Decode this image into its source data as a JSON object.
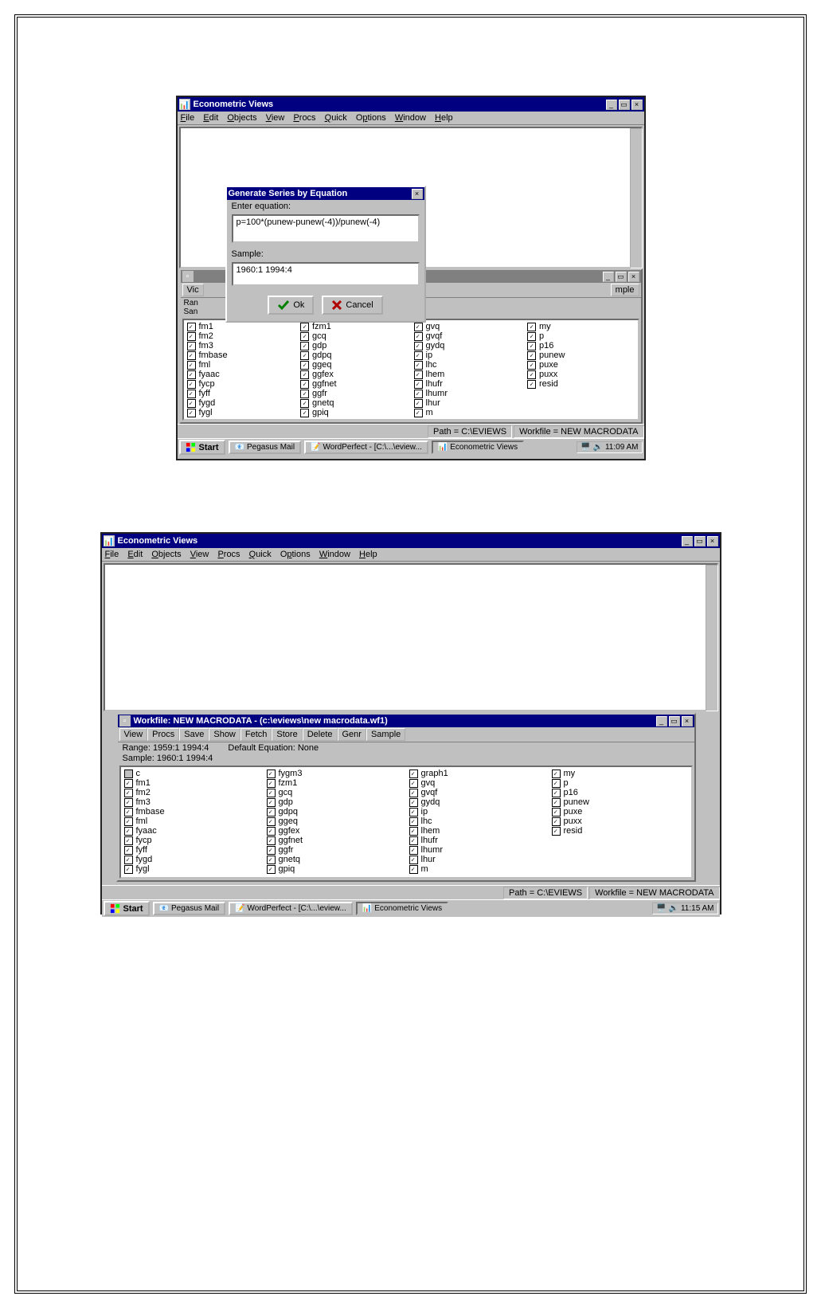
{
  "app": {
    "title": "Econometric Views",
    "menu": [
      "File",
      "Edit",
      "Objects",
      "View",
      "Procs",
      "Quick",
      "Options",
      "Window",
      "Help"
    ]
  },
  "dialog": {
    "title": "Generate Series by Equation",
    "eq_label": "Enter equation:",
    "eq_value": "p=100*(punew-punew(-4))/punew(-4)",
    "sample_label": "Sample:",
    "sample_value": "1960:1 1994:4",
    "ok": "Ok",
    "cancel": "Cancel"
  },
  "workfile": {
    "title": "Workfile: NEW MACRODATA - (c:\\eviews\\new macrodata.wf1)",
    "toolbar": [
      "View",
      "Procs",
      "Save",
      "Show",
      "Fetch",
      "Store",
      "Delete",
      "Genr",
      "Sample"
    ],
    "range": "Range:   1959:1 1994:4",
    "default_eq": "Default Equation: None",
    "sample": "Sample: 1960:1 1994:4",
    "status_path": "Path = C:\\EVIEWS",
    "status_wf": "Workfile = NEW MACRODATA"
  },
  "fig1_inner": {
    "vic": "Vic",
    "ran": "Ran",
    "sam": "San",
    "mple": "mple"
  },
  "series_col1": [
    "c",
    "fm1",
    "fm2",
    "fm3",
    "fmbase",
    "fml",
    "fyaac",
    "fycp",
    "fyff",
    "fygd",
    "fygl"
  ],
  "series_col1_partial": [
    "fm1",
    "fm2",
    "fm3",
    "fmbase",
    "fml",
    "fyaac",
    "fycp",
    "fyff",
    "fygd",
    "fygl"
  ],
  "series_col2_top_partial": [
    "fzm1"
  ],
  "series_col2": [
    "fygm3",
    "fzm1",
    "gcq",
    "gdp",
    "gdpq",
    "ggeq",
    "ggfex",
    "ggfnet",
    "ggfr",
    "gnetq",
    "gpiq"
  ],
  "series_col2_partial": [
    "gcq",
    "gdp",
    "gdpq",
    "ggeq",
    "ggfex",
    "ggfnet",
    "ggfr",
    "gnetq",
    "gpiq"
  ],
  "series_col3": [
    "graph1",
    "gvq",
    "gvqf",
    "gydq",
    "ip",
    "lhc",
    "lhem",
    "lhufr",
    "lhumr",
    "lhur",
    "m"
  ],
  "series_col3_partial": [
    "gvq",
    "gvqf",
    "gydq",
    "ip",
    "lhc",
    "lhem",
    "lhufr",
    "lhumr",
    "lhur",
    "m"
  ],
  "series_col4": [
    "my",
    "p",
    "p16",
    "punew",
    "puxe",
    "puxx",
    "resid"
  ],
  "taskbar": {
    "start": "Start",
    "btn1": "Pegasus Mail",
    "btn2": "WordPerfect - [C:\\...\\eview...",
    "btn3": "Econometric Views",
    "time1": "11:09 AM",
    "time2": "11:15 AM"
  }
}
